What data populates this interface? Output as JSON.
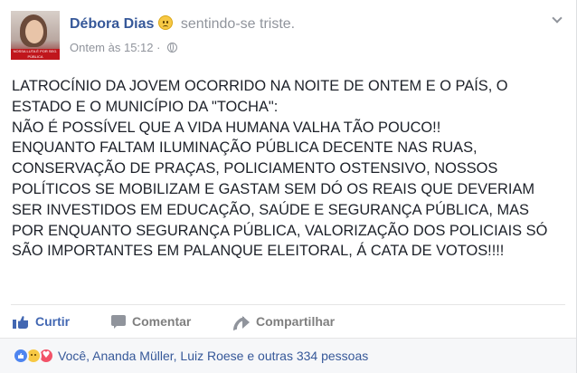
{
  "header": {
    "author_name": "Débora Dias",
    "feeling_icon": "sad-face-icon",
    "feeling_text": "sentindo-se triste.",
    "timestamp": "Ontem às 15:12",
    "separator": "·",
    "privacy_icon": "globe-icon",
    "avatar_caption": "NOSSA LUTA É POR SEG. PÚBLICA"
  },
  "post": {
    "text": "LATROCÍNIO DA JOVEM OCORRIDO NA NOITE DE ONTEM E O PAÍS, O ESTADO E O MUNICÍPIO DA \"TOCHA\":\nNÃO É POSSÍVEL QUE A VIDA HUMANA VALHA TÃO POUCO!!\nENQUANTO FALTAM ILUMINAÇÃO PÚBLICA DECENTE NAS RUAS, CONSERVAÇÃO DE PRAÇAS, POLICIAMENTO OSTENSIVO, NOSSOS POLÍTICOS SE MOBILIZAM E GASTAM SEM DÓ OS REAIS QUE DEVERIAM SER INVESTIDOS EM EDUCAÇÃO, SAÚDE E SEGURANÇA PÚBLICA, MAS POR ENQUANTO SEGURANÇA PÚBLICA, VALORIZAÇÃO DOS POLICIAIS SÓ SÃO IMPORTANTES EM PALANQUE ELEITORAL, Á CATA DE VOTOS!!!!"
  },
  "actions": {
    "like_label": "Curtir",
    "comment_label": "Comentar",
    "share_label": "Compartilhar"
  },
  "reactions": {
    "icons": [
      "like-reaction-icon",
      "sad-reaction-icon",
      "love-reaction-icon"
    ],
    "summary": "Você, Ananda Müller, Luiz Roese e outras 334 pessoas"
  },
  "colors": {
    "link_blue": "#365899",
    "like_blue": "#4267b2",
    "meta_gray": "#90949c",
    "footer_bg": "#f6f7f9"
  }
}
